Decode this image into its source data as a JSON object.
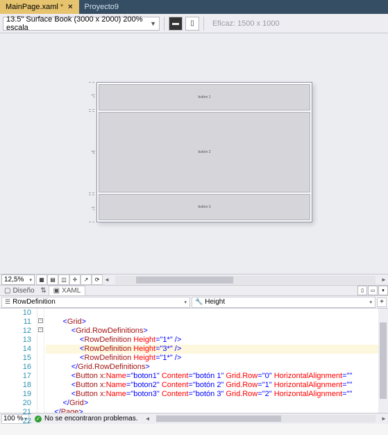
{
  "tabs": {
    "items": [
      {
        "label": "MainPage.xaml",
        "dirty": "*",
        "active": true
      },
      {
        "label": "Proyecto9",
        "dirty": "",
        "active": false
      }
    ]
  },
  "toolbar": {
    "device": "13.5\" Surface Book (3000 x 2000) 200% escala",
    "effective": "Eficaz: 1500 x 1000"
  },
  "designer": {
    "rows": [
      {
        "label": "button 1",
        "ruler": "1*"
      },
      {
        "label": "button 2",
        "ruler": "3*"
      },
      {
        "label": "button 3",
        "ruler": "1*"
      }
    ]
  },
  "midrow": {
    "zoom": "12,5%"
  },
  "dxrow": {
    "design": "Diseño",
    "xaml": "XAML"
  },
  "navbar": {
    "scope_icon": "☰",
    "scope": "RowDefinition",
    "member_icon": "🔧",
    "member": "Height"
  },
  "code": {
    "first_line_no": 10,
    "highlight_index": 4,
    "lines": [
      {
        "indent": 2,
        "raw": ""
      },
      {
        "indent": 2,
        "open": "Grid",
        "rest": ">"
      },
      {
        "indent": 3,
        "open": "Grid.RowDefinitions",
        "rest": ">"
      },
      {
        "indent": 4,
        "open": "RowDefinition",
        "attrs": [
          [
            "Height",
            "1*"
          ]
        ],
        "selfclose": true
      },
      {
        "indent": 4,
        "open": "RowDefinition",
        "attrs": [
          [
            "Height",
            "3*"
          ]
        ],
        "selfclose": true
      },
      {
        "indent": 4,
        "open": "RowDefinition",
        "attrs": [
          [
            "Height",
            "1*"
          ]
        ],
        "selfclose": true
      },
      {
        "indent": 3,
        "close": "Grid.RowDefinitions"
      },
      {
        "indent": 3,
        "open": "Button",
        "attrs_ns": [
          [
            "x:",
            "Name",
            "boton1"
          ]
        ],
        "attrs": [
          [
            "Content",
            "botón 1"
          ],
          [
            "Grid.Row",
            "0"
          ],
          [
            "HorizontalAlignment",
            ""
          ]
        ],
        "trail": true
      },
      {
        "indent": 3,
        "open": "Button",
        "attrs_ns": [
          [
            "x:",
            "Name",
            "boton2"
          ]
        ],
        "attrs": [
          [
            "Content",
            "botón 2"
          ],
          [
            "Grid.Row",
            "1"
          ],
          [
            "HorizontalAlignment",
            ""
          ]
        ],
        "trail": true
      },
      {
        "indent": 3,
        "open": "Button",
        "attrs_ns": [
          [
            "x:",
            "Name",
            "boton3"
          ]
        ],
        "attrs": [
          [
            "Content",
            "botón 3"
          ],
          [
            "Grid.Row",
            "2"
          ],
          [
            "HorizontalAlignment",
            ""
          ]
        ],
        "trail": true
      },
      {
        "indent": 2,
        "close": "Grid"
      },
      {
        "indent": 1,
        "close": "Page"
      },
      {
        "indent": 0,
        "raw": ""
      }
    ]
  },
  "status": {
    "zoom": "100 %",
    "message": "No se encontraron problemas."
  }
}
